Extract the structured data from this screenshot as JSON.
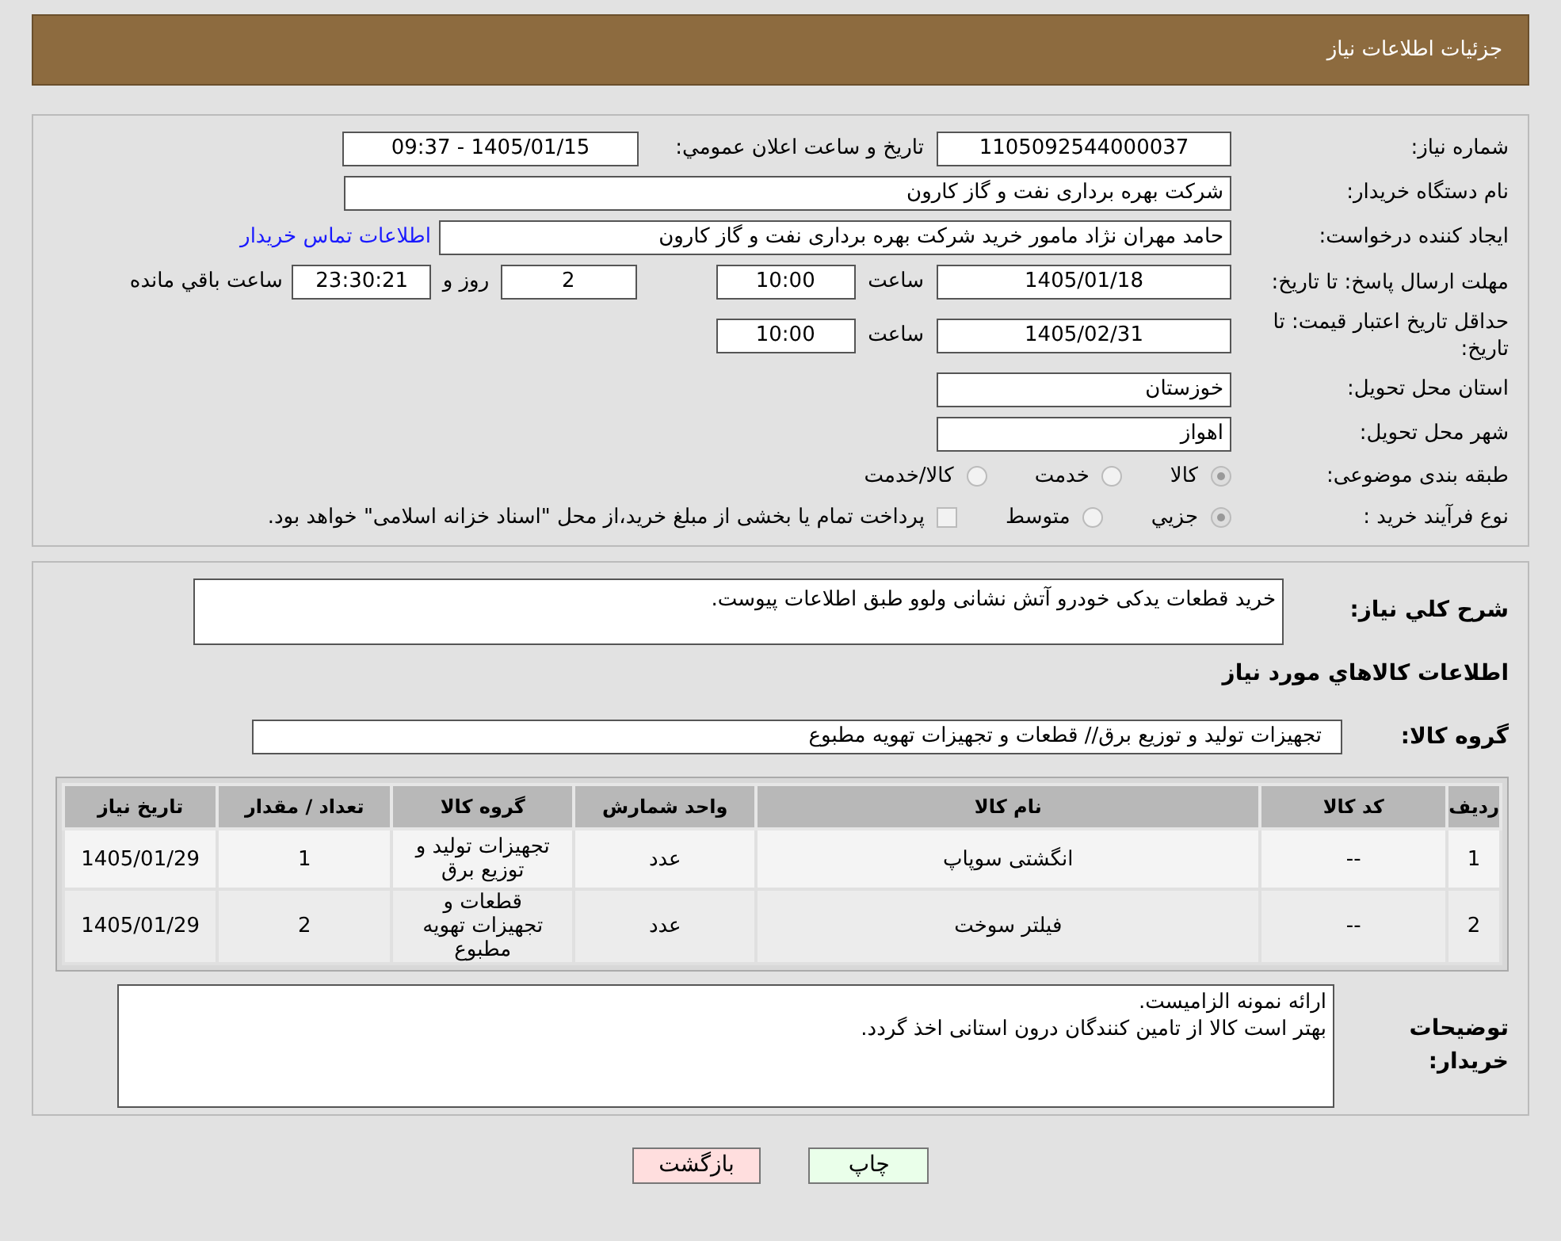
{
  "header": {
    "title": "جزئیات اطلاعات نیاز"
  },
  "need_number": {
    "label": "شماره نیاز:",
    "value": "1105092544000037"
  },
  "announce": {
    "label": "تاريخ و ساعت اعلان عمومي:",
    "value": "1405/01/15 - 09:37"
  },
  "buyer_org": {
    "label": "نام دستگاه خریدار:",
    "value": "شرکت بهره برداری نفت و گاز کارون"
  },
  "requester": {
    "label": "ایجاد کننده درخواست:",
    "value": "حامد مهران نژاد مامور خرید شرکت بهره برداری نفت و گاز کارون",
    "link": "اطلاعات تماس خریدار"
  },
  "deadline": {
    "label": "مهلت ارسال پاسخ: تا تاریخ:",
    "date": "1405/01/18",
    "time_label": "ساعت",
    "time": "10:00",
    "days": "2",
    "days_label": "روز و",
    "remaining": "23:30:21",
    "remaining_label": "ساعت باقي مانده"
  },
  "validity": {
    "label": "حداقل تاریخ اعتبار قیمت: تا تاریخ:",
    "date": "1405/02/31",
    "time_label": "ساعت",
    "time": "10:00"
  },
  "province": {
    "label": "استان محل تحویل:",
    "value": "خوزستان"
  },
  "city": {
    "label": "شهر محل تحویل:",
    "value": "اهواز"
  },
  "category": {
    "label": "طبقه بندی موضوعی:",
    "options": [
      {
        "label": "کالا",
        "selected": true
      },
      {
        "label": "خدمت",
        "selected": false
      },
      {
        "label": "کالا/خدمت",
        "selected": false
      }
    ]
  },
  "process": {
    "label": "نوع فرآیند خرید :",
    "options": [
      {
        "label": "جزیي",
        "selected": true
      },
      {
        "label": "متوسط",
        "selected": false
      }
    ],
    "checkbox": {
      "label": "پرداخت تمام یا بخشی از مبلغ خرید،از محل \"اسناد خزانه اسلامی\" خواهد بود.",
      "checked": false
    }
  },
  "description": {
    "label": "شرح کلي نياز:",
    "value": "خرید قطعات یدکی خودرو آتش نشانی ولوو طبق اطلاعات پیوست."
  },
  "goods_title": "اطلاعات کالاهاي مورد نياز",
  "group": {
    "label": "گروه کالا:",
    "value": "تجهیزات تولید و توزیع برق//  قطعات و تجهیزات تهویه مطبوع"
  },
  "table": {
    "columns": [
      "ردیف",
      "کد کالا",
      "نام کالا",
      "واحد شمارش",
      "گروه کالا",
      "تعداد / مقدار",
      "تاریخ نیاز"
    ],
    "rows": [
      [
        "1",
        "--",
        "انگشتی سوپاپ",
        "عدد",
        "تجهیزات تولید و توزیع برق",
        "1",
        "1405/01/29"
      ],
      [
        "2",
        "--",
        "فیلتر سوخت",
        "عدد",
        "قطعات و تجهیزات تهویه مطبوع",
        "2",
        "1405/01/29"
      ]
    ]
  },
  "notes": {
    "label": "توضیحات خریدار:",
    "lines": [
      "ارائه نمونه الزامیست.",
      "بهتر است  کالا از  تامین کنندگان درون استانی اخذ گردد."
    ]
  },
  "buttons": [
    {
      "label": "چاپ",
      "kind": "print"
    },
    {
      "label": "بازگشت",
      "kind": "back"
    }
  ]
}
